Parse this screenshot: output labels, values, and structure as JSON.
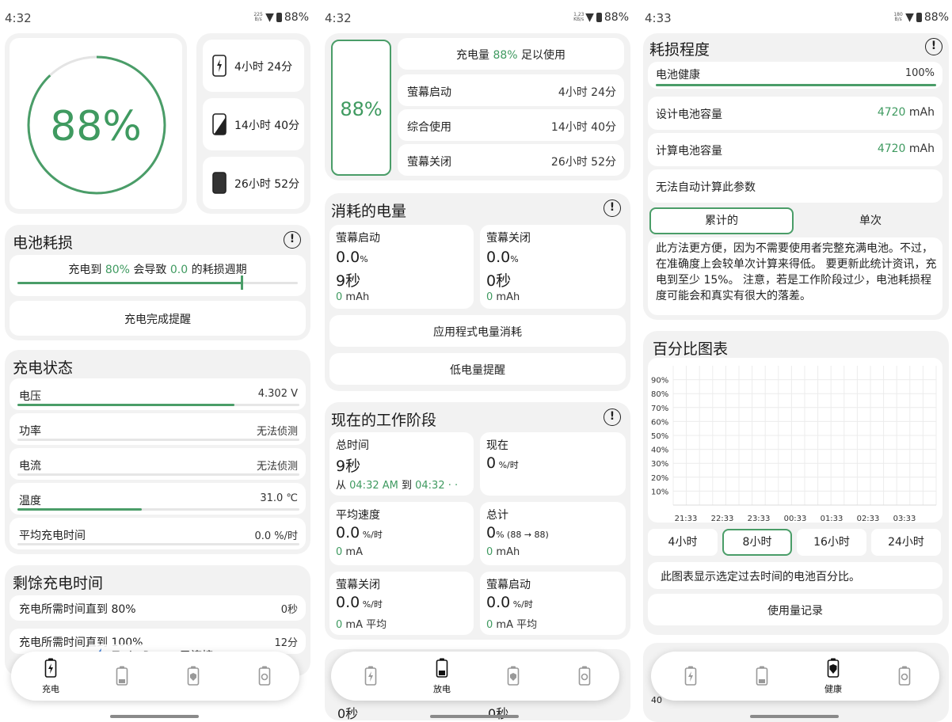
{
  "status": {
    "s1": {
      "time": "4:32",
      "net_top": "225",
      "net_bottom": "B/s",
      "battery": "88%"
    },
    "s2": {
      "time": "4:32",
      "net_top": "1.23",
      "net_bottom": "KB/s",
      "battery": "88%"
    },
    "s3": {
      "time": "4:33",
      "net_top": "180",
      "net_bottom": "B/s",
      "battery": "88%"
    }
  },
  "colors": {
    "accent": "#4a9d68",
    "card": "#f2f2f2"
  },
  "charge": {
    "percent": "88%",
    "percent_value": 0.88,
    "times": [
      "4小时 24分",
      "14小时 40分",
      "26小时 52分"
    ],
    "wear_title": "电池耗损",
    "wear_text_a": "充电到 ",
    "wear_pct": "80%",
    "wear_text_b": " 会导致 ",
    "wear_cycles": "0.0",
    "wear_text_c": " 的耗损週期",
    "wear_slider_value": 0.8,
    "charge_alert": "充电完成提醒",
    "status_title": "充电状态",
    "rows": [
      {
        "label": "电压",
        "value": "4.302 V",
        "fill": 0.77
      },
      {
        "label": "功率",
        "value": "无法侦测",
        "fill": 0
      },
      {
        "label": "电流",
        "value": "无法侦测",
        "fill": 0
      },
      {
        "label": "温度",
        "value": "31.0 ℃",
        "fill": 0.44
      },
      {
        "label": "平均充电时间",
        "value": "0.0 %/时",
        "fill": 0
      }
    ],
    "remain_title": "剩馀充电时间",
    "remain_rows": [
      {
        "label": "充电所需时间直到 80%",
        "value": "0秒"
      },
      {
        "label": "充电所需时间直到 100%",
        "value": "12分"
      }
    ],
    "toast": "TurboPower 已连接"
  },
  "discharge": {
    "percent": "88%",
    "summary_a": "充电量 ",
    "summary_pct": "88%",
    "summary_b": " 足以使用",
    "rows": [
      {
        "label": "萤幕启动",
        "value": "4小时 24分"
      },
      {
        "label": "综合使用",
        "value": "14小时 40分"
      },
      {
        "label": "萤幕关闭",
        "value": "26小时 52分"
      }
    ],
    "consumed_title": "消耗的电量",
    "on": {
      "label": "萤幕启动",
      "pct": "0.0",
      "unit": "%",
      "time": "9秒",
      "mah": "0",
      "mah_unit": " mAh"
    },
    "off": {
      "label": "萤幕关闭",
      "pct": "0.0",
      "unit": "%",
      "time": "0秒",
      "mah": "0",
      "mah_unit": " mAh"
    },
    "app_usage": "应用程式电量消耗",
    "low_alert": "低电量提醒",
    "session_title": "现在的工作阶段",
    "total_time": {
      "label": "总时间",
      "value": "9秒",
      "from": "从 ",
      "start": "04:32 AM",
      "to": " 到 ",
      "end": "04:32 · ·"
    },
    "now": {
      "label": "现在",
      "value": "0",
      "unit": " %/时"
    },
    "avg": {
      "label": "平均速度",
      "value": "0.0",
      "unit": " %/时",
      "ma": "0",
      "ma_unit": " mA"
    },
    "total": {
      "label": "总计",
      "value": "0",
      "unit": "% (88 → 88)",
      "mah": "0",
      "mah_unit": " mAh"
    },
    "screen_off": {
      "label": "萤幕关闭",
      "value": "0.0",
      "unit": " %/时",
      "ma": "0",
      "ma_unit": " mA 平均"
    },
    "screen_on": {
      "label": "萤幕启动",
      "value": "0.0",
      "unit": " %/时",
      "ma": "0",
      "ma_unit": " mA 平均"
    },
    "cut_a": "0秒",
    "cut_b": "0秒"
  },
  "health": {
    "title": "耗损程度",
    "health_label": "电池健康",
    "health_value": "100%",
    "health_fill": 1.0,
    "design_label": "设计电池容量",
    "design_value": "4720",
    "calc_label": "计算电池容量",
    "calc_value": "4720",
    "unit": " mAh",
    "cannot": "无法自动计算此参数",
    "tabs": [
      "累计的",
      "单次"
    ],
    "paragraph": "此方法更方便，因为不需要使用者完整充满电池。不过，在准确度上会较单次计算来得低。 要更新此统计资讯，充电到至少 15%。 注意，若是工作阶段过少，电池耗损程度可能会和真实有很大的落差。",
    "chart_title": "百分比图表",
    "ranges": [
      "4小时",
      "8小时",
      "16小时",
      "24小时"
    ],
    "chart_caption": "此图表显示选定过去时间的电池百分比。",
    "usage_log": "使用量记录",
    "cut_label": "40"
  },
  "nav": {
    "charge": "充电",
    "discharge": "放电",
    "health": "健康"
  },
  "chart_data": {
    "type": "line",
    "title": "百分比图表",
    "y_ticks": [
      "90%",
      "80%",
      "70%",
      "60%",
      "50%",
      "40%",
      "30%",
      "20%",
      "10%"
    ],
    "x_ticks": [
      "21:33",
      "22:33",
      "23:33",
      "00:33",
      "01:33",
      "02:33",
      "03:33"
    ],
    "ylim": [
      0,
      100
    ],
    "grid": true,
    "series": []
  }
}
